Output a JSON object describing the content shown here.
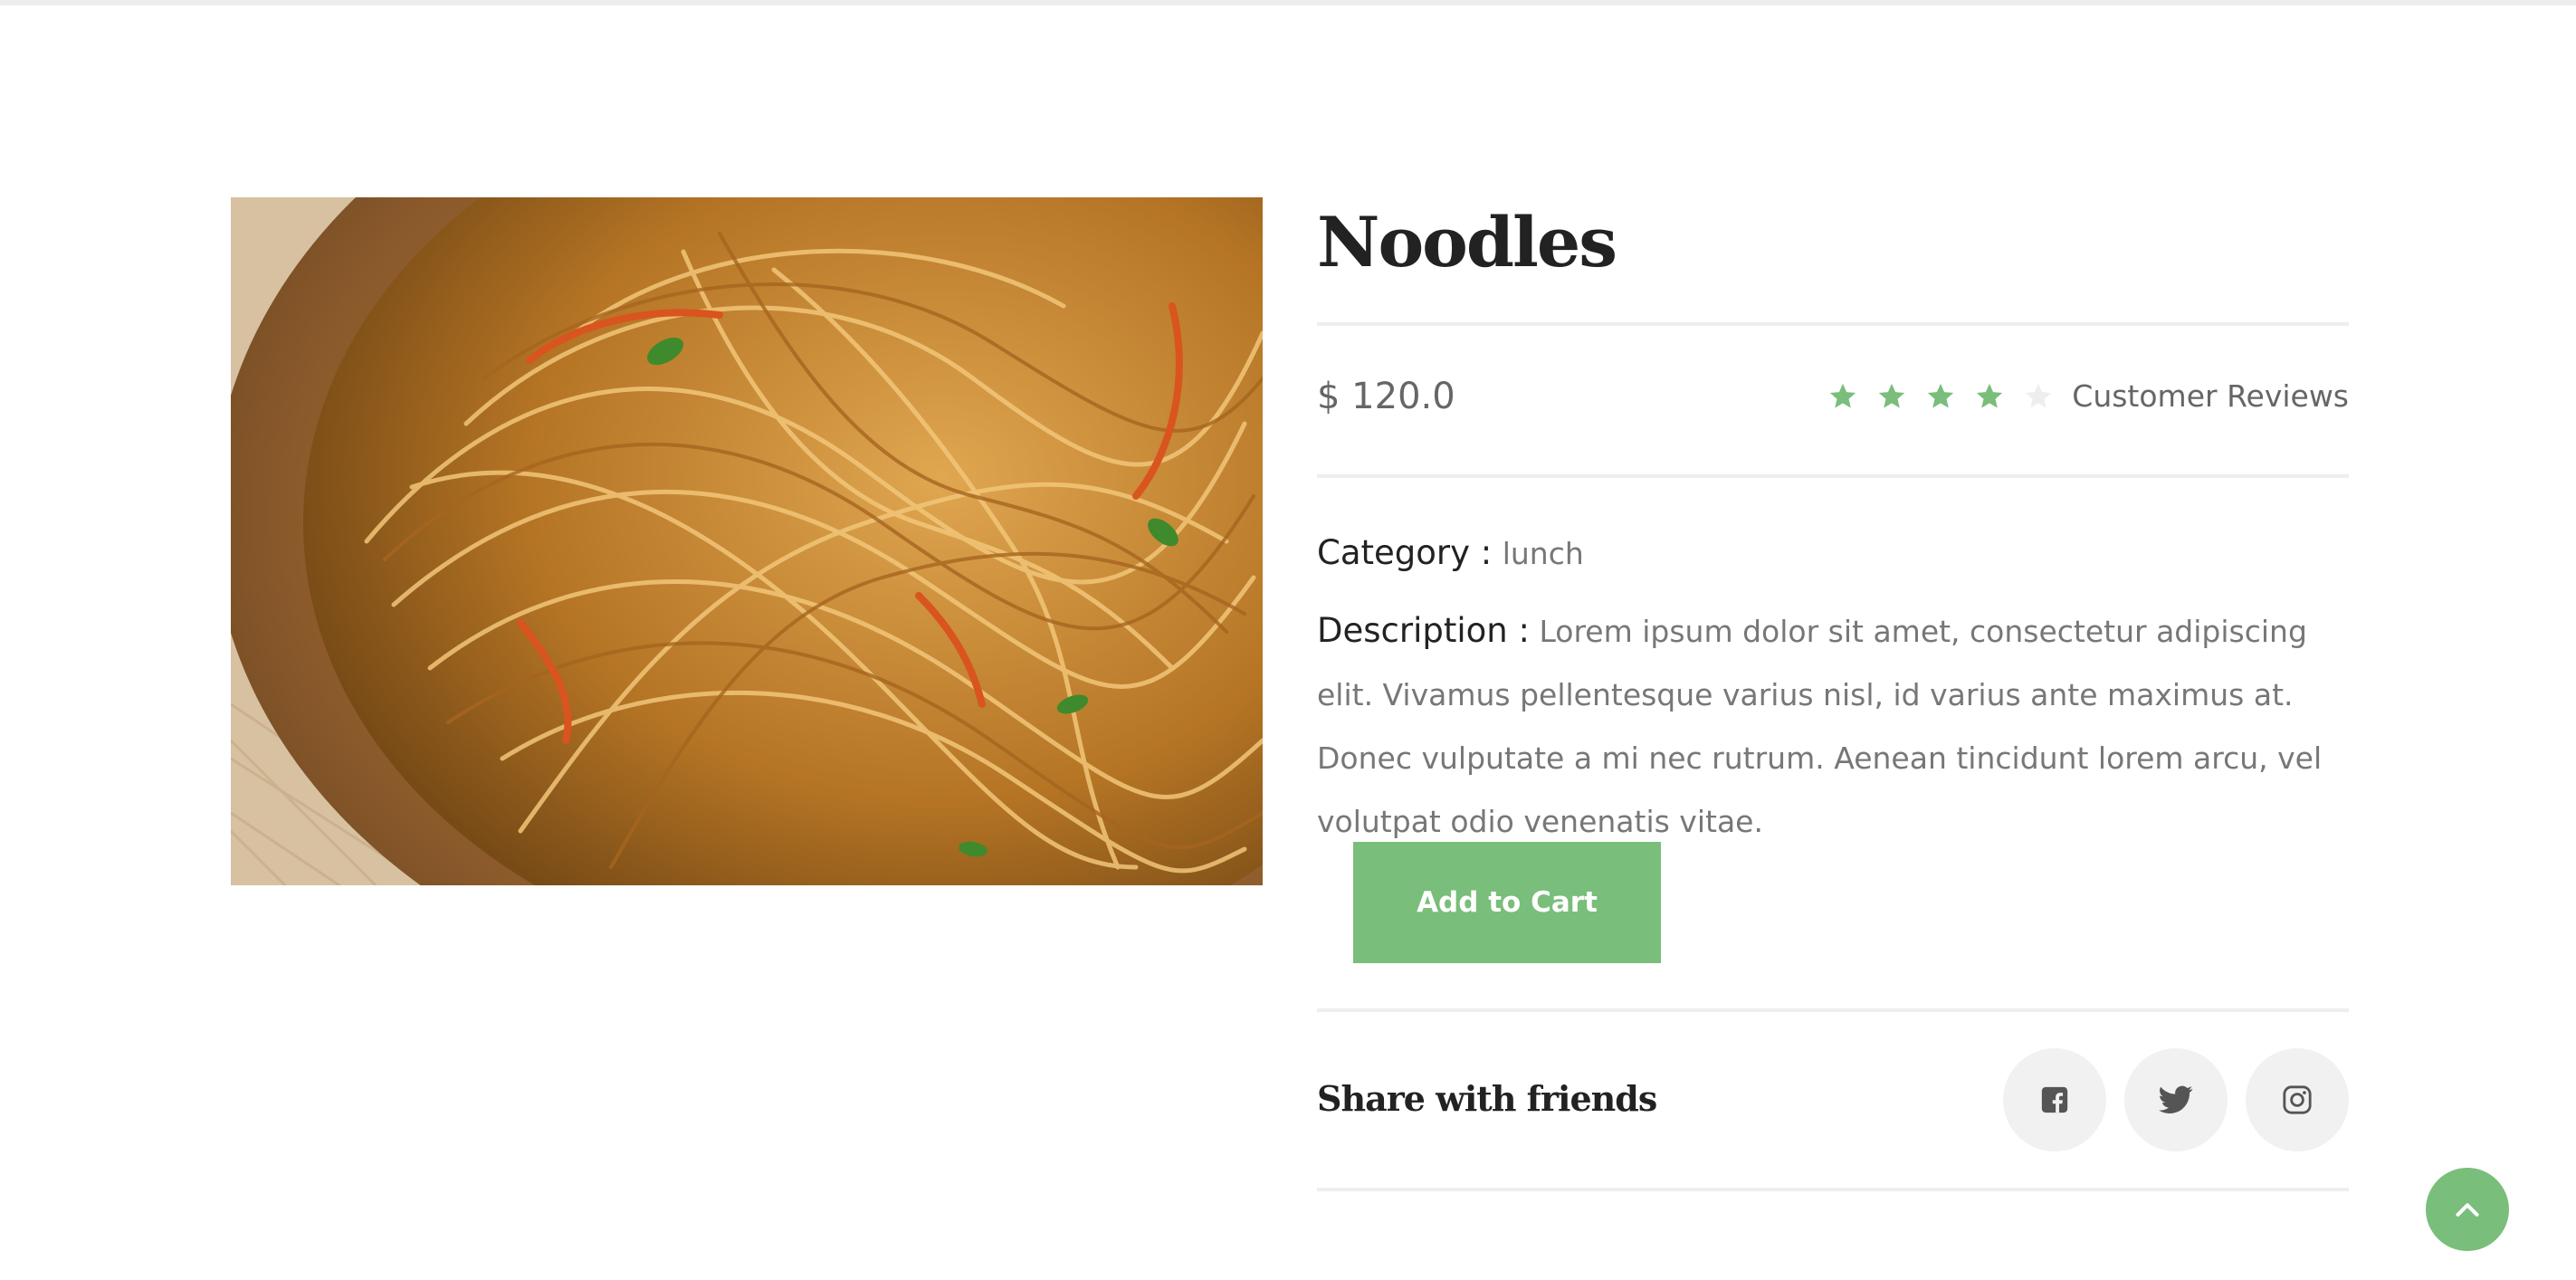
{
  "product": {
    "title": "Noodles",
    "price": "$ 120.0",
    "rating": {
      "value": 4,
      "max": 5
    },
    "reviews_label": "Customer Reviews",
    "category_label": "Category :",
    "category_value": "lunch",
    "description_label": "Description :",
    "description_text": "Lorem ipsum dolor sit amet, consectetur adipiscing elit. Vivamus pellentesque varius nisl, id varius ante maximus at. Donec vulputate a mi nec rutrum. Aenean tincidunt lorem arcu, vel volutpat odio venenatis vitae.",
    "add_to_cart_label": "Add to Cart"
  },
  "share": {
    "title": "Share with friends",
    "icons": [
      "facebook-icon",
      "twitter-icon",
      "instagram-icon"
    ]
  },
  "icons": {
    "back_to_top": "chevron-up-icon",
    "star": "star-icon"
  },
  "colors": {
    "accent": "#79be7a",
    "star_empty": "#eeeeee",
    "icon_bg": "#f1f1f1",
    "heading": "#222222",
    "text": "#666666"
  }
}
